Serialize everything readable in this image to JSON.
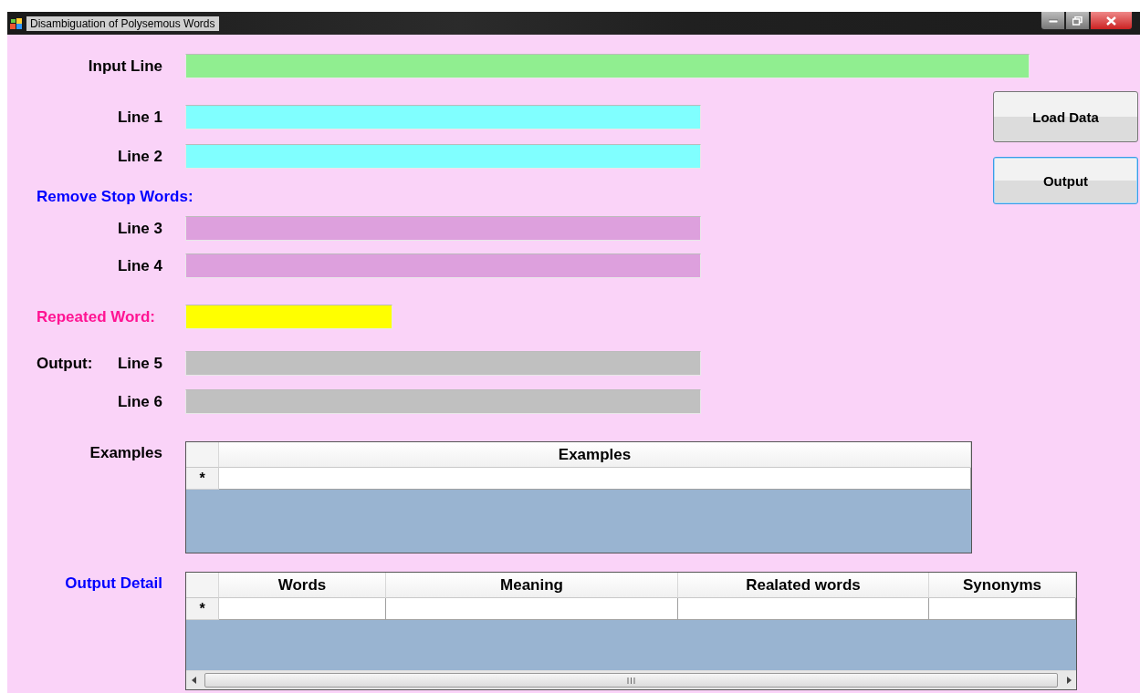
{
  "window": {
    "title": "Disambiguation of Polysemous Words"
  },
  "input": {
    "label": "Input Line",
    "color": "#90ee90"
  },
  "rows": [
    {
      "kind": "field",
      "label": "Line 1",
      "color": "#80ffff"
    },
    {
      "kind": "field",
      "label": "Line 2",
      "color": "#80ffff"
    },
    {
      "kind": "heading",
      "label": "Remove Stop Words:",
      "color": "#0000ff"
    },
    {
      "kind": "field",
      "label": "Line 3",
      "color": "#dda0dd"
    },
    {
      "kind": "field",
      "label": "Line 4",
      "color": "#dda0dd"
    },
    {
      "kind": "flag",
      "label": {
        "text": "Repeated Word:",
        "color": "#ff1493"
      },
      "field": {
        "color": "#ffff00"
      }
    },
    {
      "kind": "field",
      "prefix": "Output:",
      "label": "Line 5",
      "color": "#c0c0c0"
    },
    {
      "kind": "field",
      "label": "Line 6",
      "color": "#c0c0c0"
    }
  ],
  "buttons": [
    {
      "label": "Load Data",
      "focused": false
    },
    {
      "label": "Output",
      "focused": true
    }
  ],
  "examples": {
    "label": {
      "text": "Examples",
      "color": "#000000"
    },
    "columns": [
      "Examples"
    ],
    "new_row_marker": "*"
  },
  "output_detail": {
    "label": {
      "text": "Output Detail",
      "color": "#0000ff"
    },
    "columns": [
      "Words",
      "Meaning",
      "Realated words",
      "Synonyms"
    ],
    "new_row_marker": "*"
  }
}
